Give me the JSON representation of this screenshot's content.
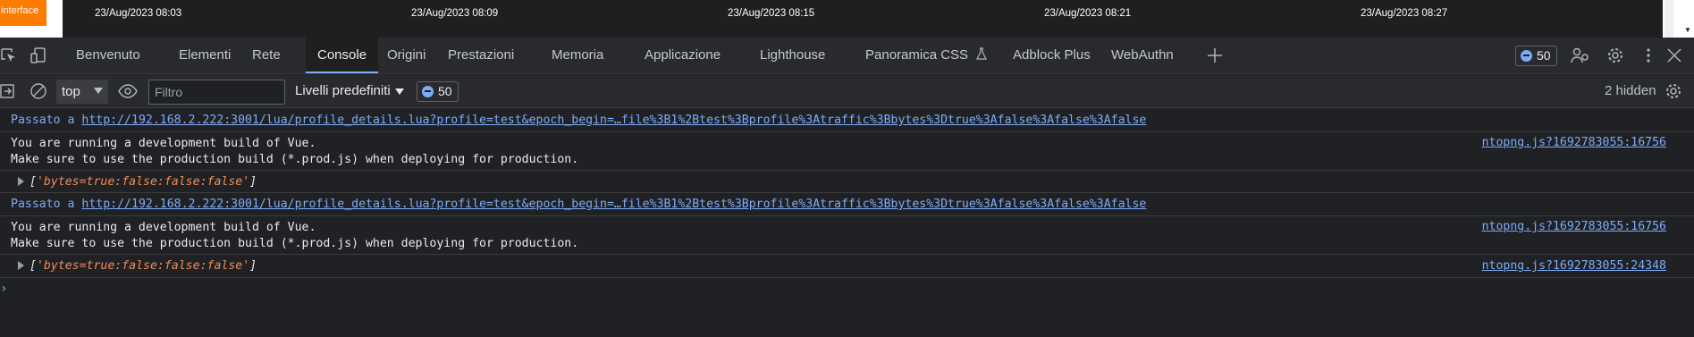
{
  "page": {
    "badge": "interface",
    "timestamps": [
      "23/Aug/2023 08:03",
      "23/Aug/2023 08:09",
      "23/Aug/2023 08:15",
      "23/Aug/2023 08:21",
      "23/Aug/2023 08:27"
    ]
  },
  "tabs": [
    "Benvenuto",
    "Elementi",
    "Rete",
    "Console",
    "Origini",
    "Prestazioni",
    "Memoria",
    "Applicazione",
    "Lighthouse",
    "Panoramica CSS",
    "Adblock Plus",
    "WebAuthn"
  ],
  "active_tab": "Console",
  "tabbar": {
    "message_count": "50"
  },
  "toolbar": {
    "context": "top",
    "filter_placeholder": "Filtro",
    "levels": "Livelli predefiniti",
    "issue_count": "50",
    "hidden": "2 hidden"
  },
  "console": {
    "nav_prefix": "Passato a",
    "nav_url": "http://192.168.2.222:3001/lua/profile_details.lua?profile=test&epoch_begin=…file%3B1%2Btest%3Bprofile%3Atraffic%3Bbytes%3Dtrue%3Afalse%3Afalse%3Afalse",
    "vue_warning_line1": "You are running a development build of Vue.",
    "vue_warning_line2": "Make sure to use the production build (*.prod.js) when deploying for production.",
    "array_value": "'bytes=true:false:false:false'",
    "source_1": "ntopng.js?1692783055:16756",
    "source_2": "ntopng.js?1692783055:16756",
    "source_3": "ntopng.js?1692783055:24348"
  },
  "colors": {
    "accent": "#7cacf8",
    "string": "#f28b54",
    "badge": "#ff7b00"
  }
}
